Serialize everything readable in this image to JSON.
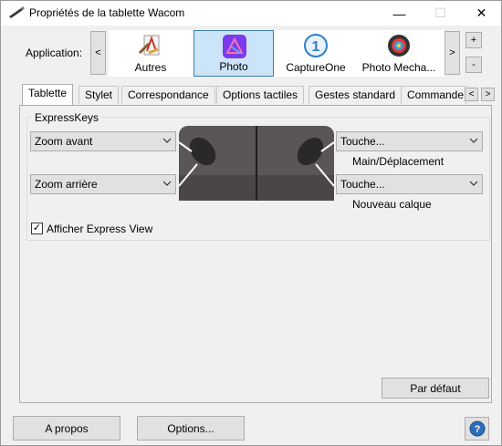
{
  "window": {
    "title": "Propriétés de la tablette Wacom",
    "controls": {
      "minimize": "—",
      "maximize": "☐",
      "close": "✕"
    }
  },
  "app_bar": {
    "label": "Application:",
    "prev_label": "<",
    "next_label": ">",
    "add_label": "+",
    "remove_label": "-",
    "apps": [
      {
        "label": "Autres",
        "icon": "others-app-icon"
      },
      {
        "label": "Photo",
        "icon": "affinity-photo-icon"
      },
      {
        "label": "CaptureOne",
        "icon": "captureone-icon"
      },
      {
        "label": "Photo Mecha...",
        "icon": "photo-mechanic-icon"
      }
    ],
    "selected_app": "Photo"
  },
  "tabs": {
    "items": [
      {
        "label": "Tablette"
      },
      {
        "label": "Stylet"
      },
      {
        "label": "Correspondance"
      },
      {
        "label": "Options tactiles"
      },
      {
        "label": "Gestes standard"
      },
      {
        "label": "Commande"
      }
    ],
    "active": "Tablette",
    "scroll_left": "<",
    "scroll_right": ">"
  },
  "expresskeys": {
    "group_title": "ExpressKeys",
    "left_top": "Zoom avant",
    "left_bottom": "Zoom arrière",
    "right_top": "Touche...",
    "right_top_sub": "Main/Déplacement",
    "right_bottom": "Touche...",
    "right_bottom_sub": "Nouveau calque",
    "show_express_view_label": "Afficher Express View",
    "show_express_view_checked": true,
    "check_glyph": "✓"
  },
  "buttons": {
    "default": "Par défaut",
    "about": "A propos",
    "options": "Options...",
    "help": "?"
  },
  "colors": {
    "selection_fill": "#cce4f7",
    "selection_border": "#3c7fb1",
    "affinity_purple": "#7c3aed",
    "help_blue": "#2a6ebb"
  }
}
